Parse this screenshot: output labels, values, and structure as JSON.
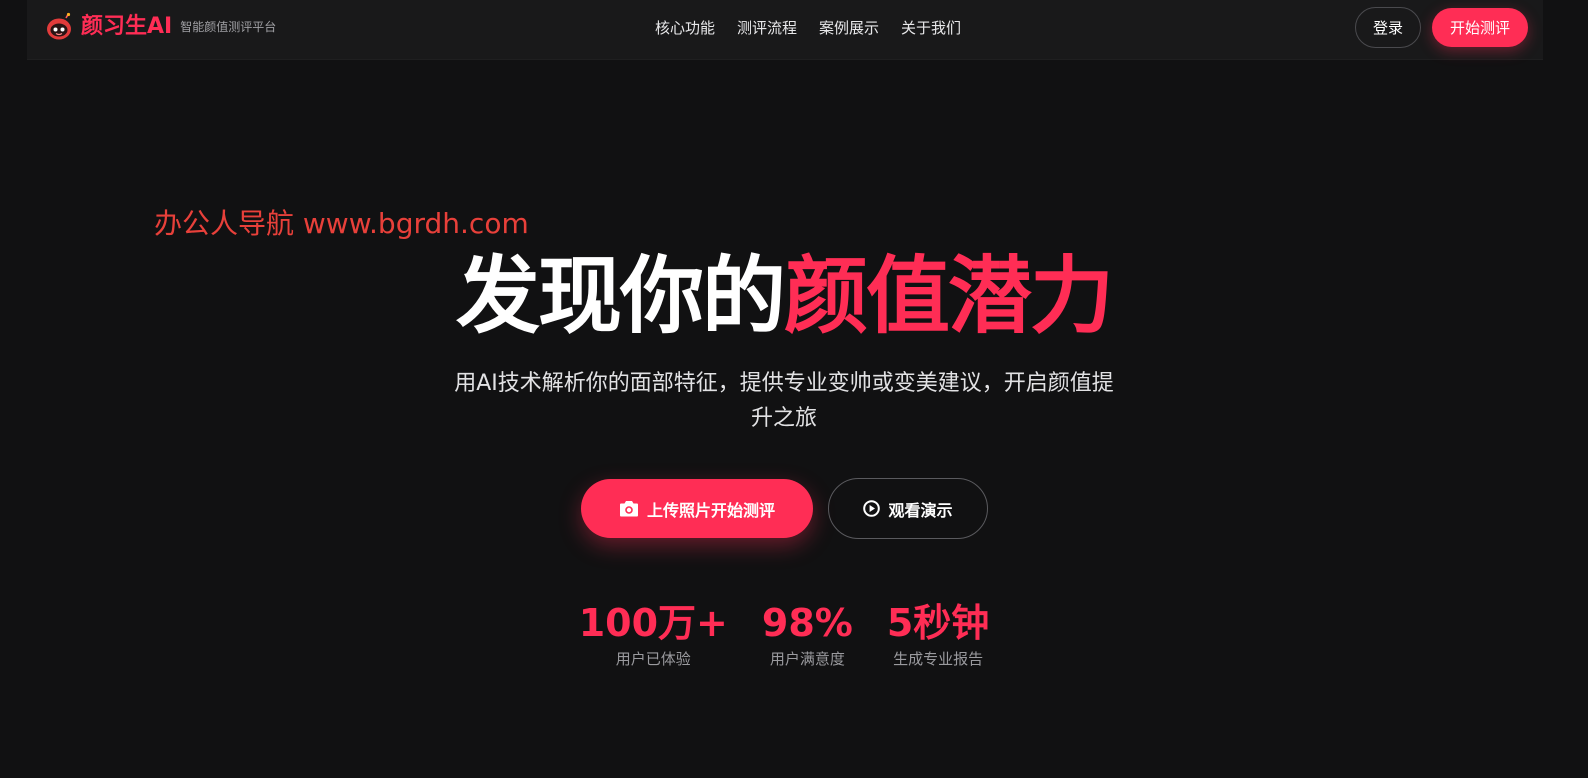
{
  "header": {
    "brand_name": "颜习生AI",
    "brand_tagline": "智能颜值测评平台",
    "logo_icon": "robot-icon",
    "nav": [
      {
        "label": "核心功能"
      },
      {
        "label": "测评流程"
      },
      {
        "label": "案例展示"
      },
      {
        "label": "关于我们"
      }
    ],
    "login_label": "登录",
    "start_label": "开始测评"
  },
  "watermark": "办公人导航  www.bgrdh.com",
  "hero": {
    "title_plain": "发现你的",
    "title_accent": "颜值潜力",
    "subtitle": "用AI技术解析你的面部特征，提供专业变帅或变美建议，开启颜值提升之旅",
    "upload_label": "上传照片开始测评",
    "upload_icon": "camera-icon",
    "demo_label": "观看演示",
    "demo_icon": "play-circle-icon"
  },
  "stats": [
    {
      "value": "100万+",
      "label": "用户已体验"
    },
    {
      "value": "98%",
      "label": "用户满意度"
    },
    {
      "value": "5秒钟",
      "label": "生成专业报告"
    }
  ],
  "colors": {
    "accent": "#ff2d55",
    "background": "#111112",
    "navbar": "#19191a",
    "watermark": "#e8403a"
  }
}
